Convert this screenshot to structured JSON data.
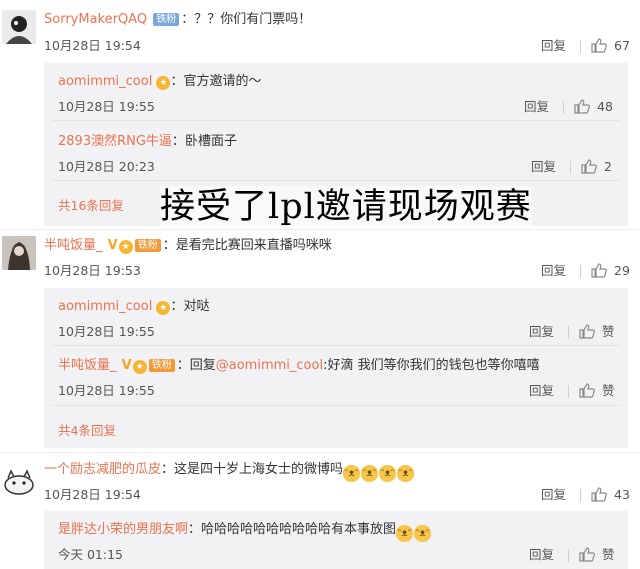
{
  "comments": [
    {
      "user": "SorryMakerQAQ",
      "badge": "铁粉",
      "sep": "：",
      "text": "？？你们有门票吗！",
      "time": "10月28日 19:54",
      "reply": "回复",
      "likes": "67",
      "subs": [
        {
          "user": "aomimmi_cool",
          "sep": "：",
          "text": "官方邀请的～",
          "time": "10月28日 19:55",
          "reply": "回复",
          "likes": "48"
        },
        {
          "user": "2893澳然RNG牛逼",
          "sep": "：",
          "text": "卧槽面子",
          "time": "10月28日 20:23",
          "reply": "回复",
          "likes": "2"
        }
      ],
      "more": "共16条回复"
    },
    {
      "user": "半吨饭量_",
      "badge": "铁粉",
      "sep": "：",
      "text": "是看完比赛回来直播吗咪咪",
      "time": "10月28日 19:53",
      "reply": "回复",
      "likes": "29",
      "subs": [
        {
          "user": "aomimmi_cool",
          "sep": "：",
          "text": "对哒",
          "time": "10月28日 19:55",
          "reply": "回复",
          "likes": "赞"
        },
        {
          "user": "半吨饭量_",
          "badge": "铁粉",
          "sep": "：",
          "text": "回复",
          "mention": "@aomimmi_cool",
          "text2": ":好滴   我们等你我们的钱包也等你嘻嘻",
          "time": "10月28日 19:55",
          "reply": "回复",
          "likes": "赞"
        }
      ],
      "more": "共4条回复"
    },
    {
      "user": "一个励志减肥的瓜皮",
      "sep": "：",
      "text": "这是四十岁上海女士的微博吗",
      "time": "10月28日 19:54",
      "reply": "回复",
      "likes": "43",
      "subs": [
        {
          "user": "是胖达小荣的男朋友啊",
          "sep": "：",
          "text": "哈哈哈哈哈哈哈哈哈哈有本事放图",
          "time": "今天 01:15",
          "reply": "回复",
          "likes": "赞"
        }
      ]
    }
  ],
  "overlay_caption": "接受了lpl邀请现场观赛",
  "icons": {
    "like": "thumbs-up-icon",
    "vip": "vip-badge-icon",
    "verified": "verified-v-icon",
    "emoji": "cat-face-emoji"
  },
  "colors": {
    "username": "#eb7350",
    "sub_bg": "#f2f2f5",
    "text": "#333333"
  }
}
